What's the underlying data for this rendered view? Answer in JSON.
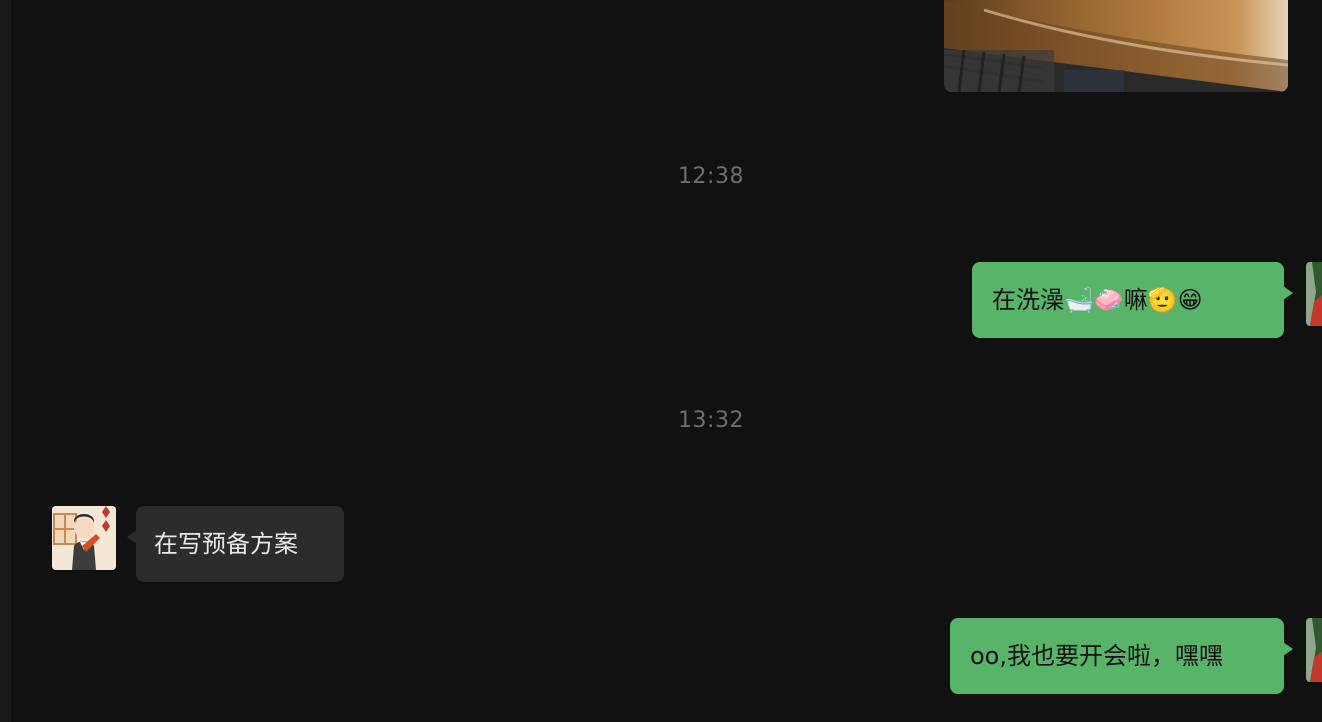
{
  "messages": {
    "time1": "12:38",
    "time2": "13:32",
    "out1_text": "在洗澡🛁🧼嘛🫡😁",
    "in1_text": "在写预备方案",
    "out2_text": "oo,我也要开会啦，嘿嘿"
  },
  "colors": {
    "background": "#111111",
    "outgoing_bubble": "#58b468",
    "incoming_bubble": "#2c2c2c",
    "timestamp": "#6e6e6e"
  },
  "icons": {
    "left_avatar": "cartoon-avatar",
    "right_avatar": "photo-avatar"
  }
}
